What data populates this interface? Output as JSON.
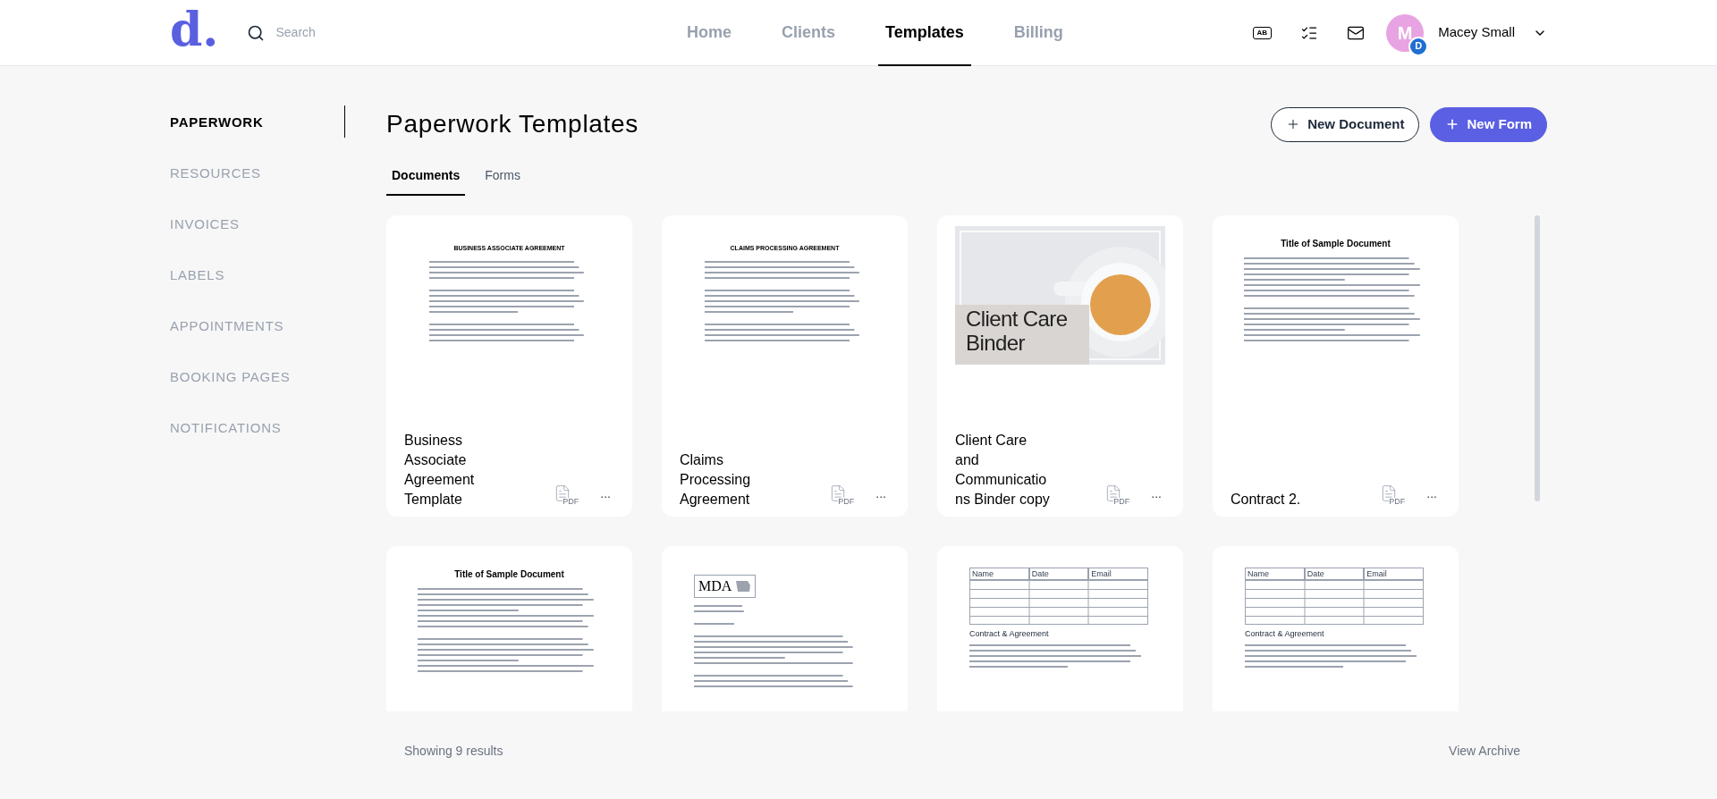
{
  "logo": {
    "letter": "d",
    "dot": "."
  },
  "search": {
    "placeholder": "Search"
  },
  "nav": [
    {
      "label": "Home",
      "selected": false
    },
    {
      "label": "Clients",
      "selected": false
    },
    {
      "label": "Templates",
      "selected": true
    },
    {
      "label": "Billing",
      "selected": false
    }
  ],
  "header_icons": {
    "keyboard_label": "AB"
  },
  "user": {
    "initial": "M",
    "badge": "D",
    "name": "Macey Small"
  },
  "sidebar": [
    {
      "label": "PAPERWORK",
      "selected": true
    },
    {
      "label": "RESOURCES",
      "selected": false
    },
    {
      "label": "INVOICES",
      "selected": false
    },
    {
      "label": "LABELS",
      "selected": false
    },
    {
      "label": "APPOINTMENTS",
      "selected": false
    },
    {
      "label": "BOOKING PAGES",
      "selected": false
    },
    {
      "label": "NOTIFICATIONS",
      "selected": false
    }
  ],
  "page_title": "Paperwork Templates",
  "actions": [
    {
      "kind": "outline",
      "label": "New Document"
    },
    {
      "kind": "primary",
      "label": "New Form"
    }
  ],
  "tabs": [
    {
      "label": "Documents",
      "selected": true
    },
    {
      "label": "Forms",
      "selected": false
    }
  ],
  "cards": [
    {
      "title": "Business Associate Agreement Template",
      "preview": {
        "kind": "agreement",
        "heading": "BUSINESS ASSOCIATE AGREEMENT"
      },
      "file": "PDF",
      "menu": "..."
    },
    {
      "title": "Claims Processing Agreement",
      "preview": {
        "kind": "agreement",
        "heading": "CLAIMS PROCESSING AGREEMENT"
      },
      "file": "PDF",
      "menu": "..."
    },
    {
      "title": "Client Care and Communications Binder copy",
      "preview": {
        "kind": "cover",
        "heading": "Client Care Binder"
      },
      "file": "PDF",
      "menu": "..."
    },
    {
      "title": "Contract 2.",
      "preview": {
        "kind": "sample",
        "heading": "Title of Sample Document"
      },
      "file": "PDF",
      "menu": "..."
    },
    {
      "preview": {
        "kind": "sample",
        "heading": "Title of Sample Document"
      }
    },
    {
      "preview": {
        "kind": "letter",
        "heading": "MDA"
      }
    },
    {
      "preview": {
        "kind": "table",
        "columns": [
          "Name",
          "Date",
          "Email"
        ],
        "heading": "Contract & Agreement"
      }
    },
    {
      "preview": {
        "kind": "table",
        "columns": [
          "Name",
          "Date",
          "Email"
        ],
        "heading": "Contract & Agreement"
      }
    }
  ],
  "footer": {
    "count": "Showing 9 results",
    "link": "View Archive"
  }
}
